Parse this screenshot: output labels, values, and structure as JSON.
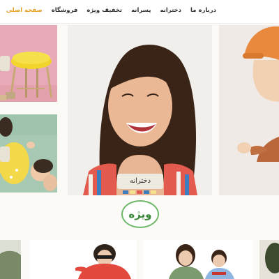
{
  "nav": {
    "items": [
      "صفحه اصلی",
      "فروشگاه",
      "تخفیف ویژه",
      "پسرانه",
      "دخترانه",
      "درباره ما"
    ]
  },
  "hero": {
    "caption": "دخترانه"
  },
  "special": {
    "badge": "ویژه"
  },
  "colors": {
    "accent": "#e6a021",
    "badge_green": "#6db86a"
  }
}
